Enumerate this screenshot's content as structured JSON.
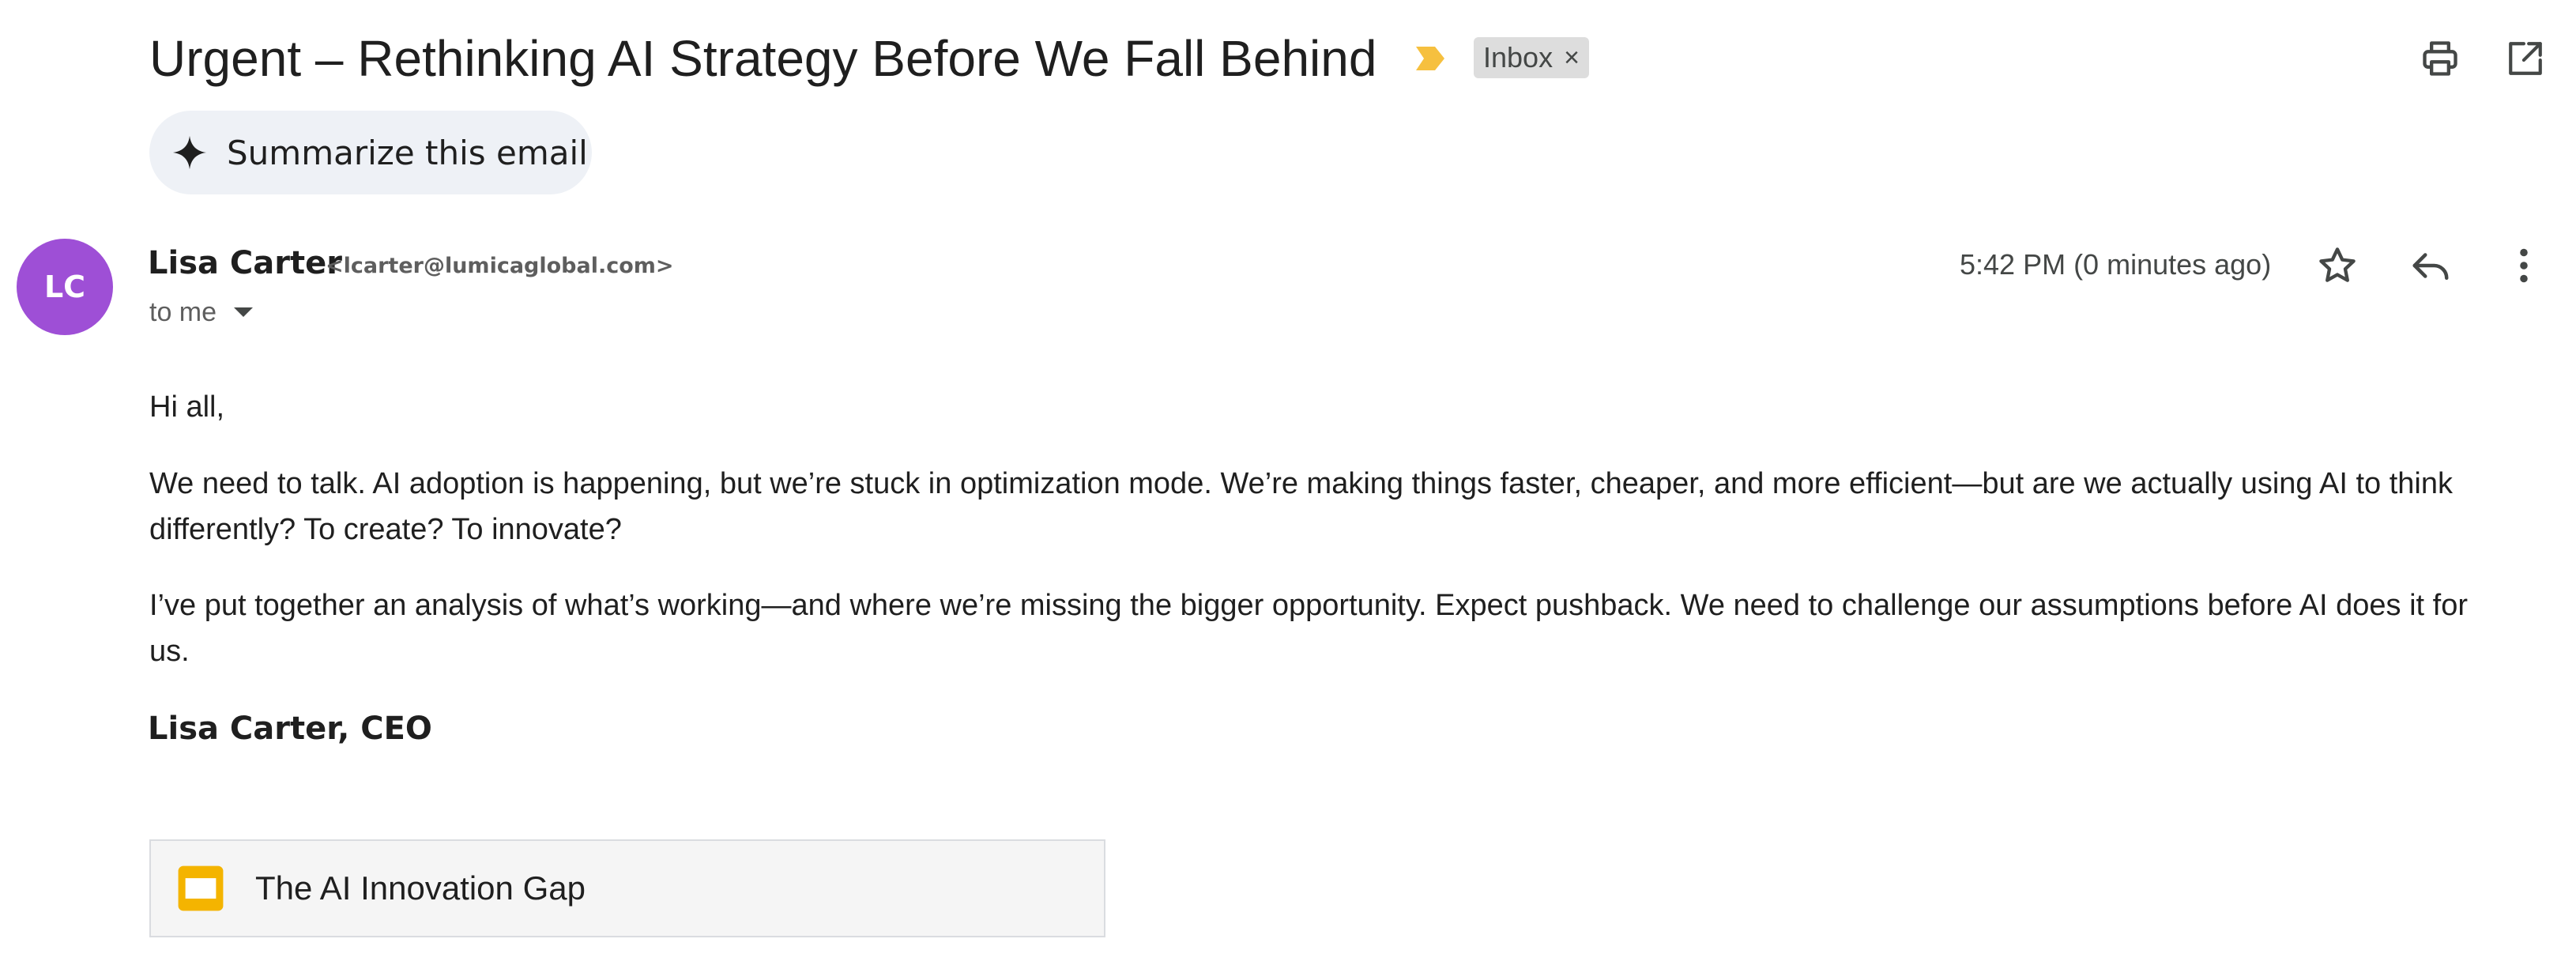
{
  "email": {
    "subject": "Urgent – Rethinking AI Strategy Before We Fall Behind",
    "label_chip": "Inbox",
    "label_chip_remove": "×",
    "importance_color": "#f6c03f"
  },
  "toolbar": {
    "print_icon": "print-icon",
    "open_new_window_icon": "open-in-new-window-icon"
  },
  "summarize": {
    "label": "Summarize this email",
    "icon": "sparkle-icon"
  },
  "sender": {
    "initials": "LC",
    "avatar_color": "#9e4fd6",
    "name": "Lisa Carter",
    "email": "<lcarter@lumicaglobal.com>",
    "recipient": "to me",
    "timestamp": "5:42 PM (0 minutes ago)"
  },
  "actions": {
    "star_icon": "star-icon",
    "reply_icon": "reply-icon",
    "more_icon": "more-vert-icon"
  },
  "body": {
    "greeting": "Hi all,",
    "paragraph1_line1": "We need to talk. AI adoption is happening, but we’re stuck in optimization mode. We’re making things faster, cheaper, and more efficient—but are we actually using AI to think",
    "paragraph1_line2": "differently? To create? To innovate?",
    "paragraph2_line1": "I’ve put together an analysis of what’s working—and where we’re missing the bigger opportunity. Expect pushback. We need to challenge our assumptions before AI does it for",
    "paragraph2_line2": "us.",
    "signature": "Lisa Carter, CEO"
  },
  "attachment": {
    "name": "The AI Innovation Gap",
    "icon": "google-slides-icon",
    "icon_color": "#f4b400"
  }
}
